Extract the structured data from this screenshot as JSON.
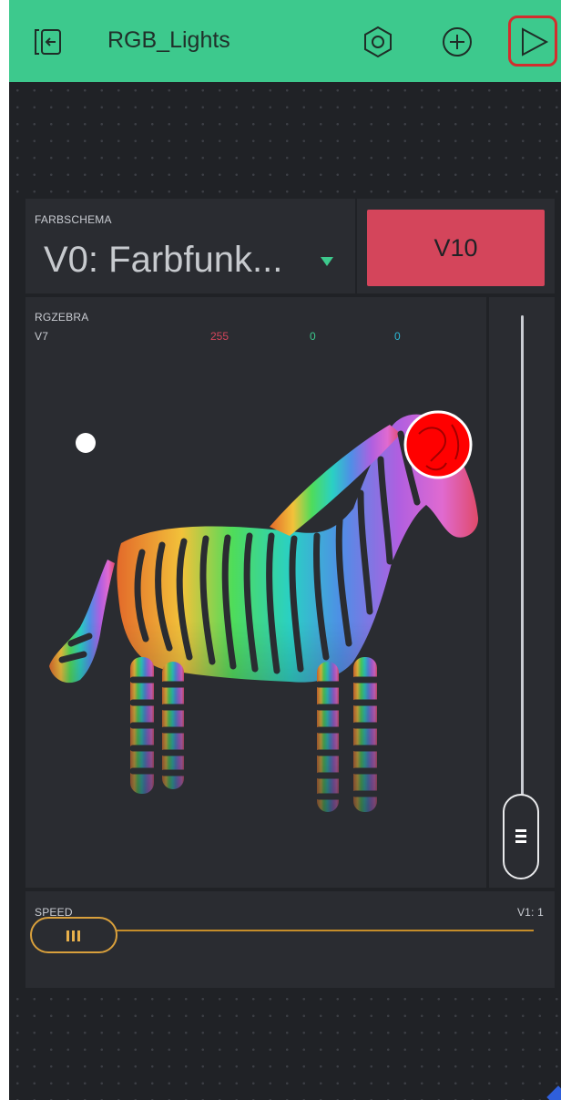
{
  "header": {
    "title": "RGB_Lights",
    "icons": [
      "exit-icon",
      "nut-settings-icon",
      "plus-circle-icon",
      "play-icon"
    ]
  },
  "farbschema": {
    "label": "FARBSCHEMA",
    "value": "V0: Farbfunk..."
  },
  "v10_button": {
    "label": "V10"
  },
  "zebra": {
    "label": "RGZEBRA",
    "pin": "V7",
    "r": "255",
    "g": "0",
    "b": "0",
    "selected_color": "#ff0000"
  },
  "vertical_slider": {
    "level": 0.0
  },
  "speed": {
    "label": "SPEED",
    "value": "V1: 1",
    "level": 0.0
  },
  "colors": {
    "header_green": "#3dc98d",
    "background": "#202226",
    "widget": "#2a2c31",
    "button_red": "#d4455b",
    "slider_orange": "#d9a03c",
    "play_highlight": "#d32d2d"
  }
}
